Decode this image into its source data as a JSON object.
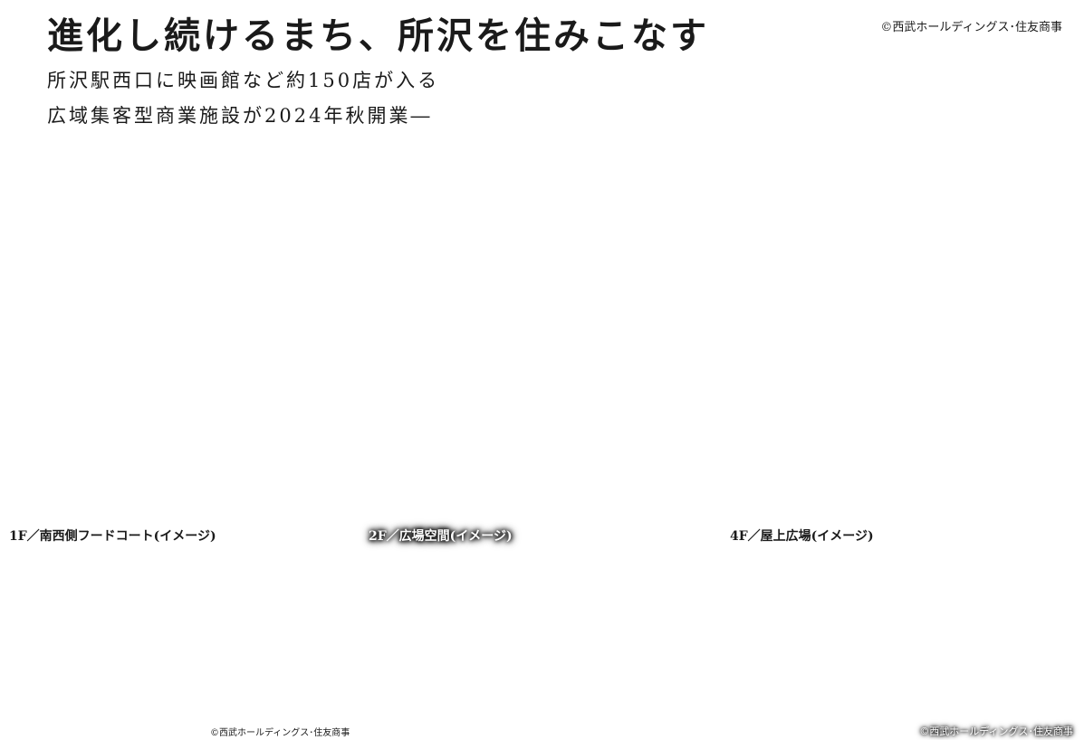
{
  "header": {
    "headline": "進化し続けるまち、所沢を住みこなす",
    "subhead_line1": "所沢駅西口に映画館など約150店が入る",
    "subhead_line2": "広域集客型商業施設が2024年秋開業―",
    "credit": "©西武ホールディングス･住友商事"
  },
  "images": [
    {
      "caption": "1F／南西側フードコート(イメージ)"
    },
    {
      "caption": "2F／広場空間(イメージ)"
    },
    {
      "caption": "4F／屋上広場(イメージ)"
    }
  ],
  "footer": {
    "credit_left": "©西武ホールディングス･住友商事",
    "credit_right": "©西武ホールディングス･住友商事"
  }
}
